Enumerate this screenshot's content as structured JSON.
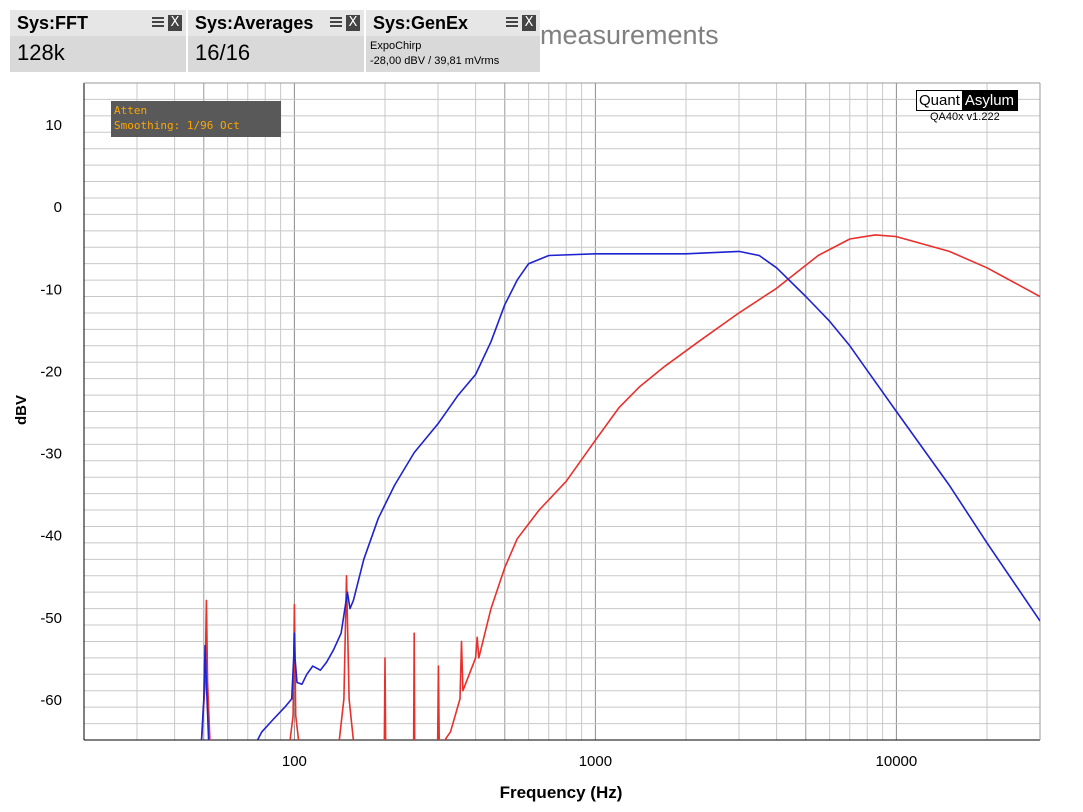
{
  "tiles": [
    {
      "title": "Sys:FFT",
      "value": "128k"
    },
    {
      "title": "Sys:Averages",
      "value": "16/16"
    },
    {
      "title": "Sys:GenEx",
      "line1": "ExpoChirp",
      "line2": "-28,00 dBV / 39,81 mVrms"
    }
  ],
  "page_title": "measurements",
  "logo": {
    "left": "Quant",
    "right": "Asylum",
    "version": "QA40x v1.222"
  },
  "status": {
    "line1": "Atten",
    "line2": "Smoothing: 1/96 Oct",
    "color": "#ffa500"
  },
  "colors": {
    "blue": "#1f22cf",
    "red": "#e8302c",
    "grid_major": "#8c8c8c",
    "grid_minor": "#c8c8c8"
  },
  "chart_data": {
    "type": "line",
    "xlabel": "Frequency (Hz)",
    "ylabel": "dBV",
    "x_scale": "log",
    "xlim": [
      20,
      30000
    ],
    "ylim": [
      -65,
      15
    ],
    "x_ticks": [
      100,
      1000,
      10000
    ],
    "y_ticks": [
      10,
      0,
      -10,
      -20,
      -30,
      -40,
      -50,
      -60
    ],
    "grid": true,
    "series": [
      {
        "color": "#1f22cf",
        "points": [
          [
            49,
            -66
          ],
          [
            50,
            -60
          ],
          [
            50.5,
            -53.5
          ],
          [
            51,
            -58
          ],
          [
            52,
            -66
          ],
          [
            73,
            -66
          ],
          [
            78,
            -64
          ],
          [
            85,
            -62.5
          ],
          [
            93,
            -61
          ],
          [
            98,
            -60
          ],
          [
            99.5,
            -55
          ],
          [
            100,
            -52
          ],
          [
            100.5,
            -55
          ],
          [
            102,
            -58
          ],
          [
            106,
            -58.2
          ],
          [
            110,
            -57
          ],
          [
            115,
            -56
          ],
          [
            122,
            -56.5
          ],
          [
            128,
            -55.5
          ],
          [
            135,
            -54
          ],
          [
            143,
            -52
          ],
          [
            150,
            -47
          ],
          [
            153,
            -49
          ],
          [
            157,
            -48
          ],
          [
            170,
            -43
          ],
          [
            190,
            -38
          ],
          [
            215,
            -34
          ],
          [
            250,
            -30
          ],
          [
            300,
            -26.5
          ],
          [
            350,
            -23
          ],
          [
            400,
            -20.5
          ],
          [
            450,
            -16.5
          ],
          [
            500,
            -12
          ],
          [
            550,
            -9
          ],
          [
            600,
            -7
          ],
          [
            700,
            -6
          ],
          [
            1000,
            -5.8
          ],
          [
            2000,
            -5.8
          ],
          [
            3000,
            -5.5
          ],
          [
            3500,
            -6
          ],
          [
            4000,
            -7.5
          ],
          [
            5000,
            -11
          ],
          [
            6000,
            -14
          ],
          [
            7000,
            -17
          ],
          [
            8000,
            -20
          ],
          [
            10000,
            -25
          ],
          [
            15000,
            -34
          ],
          [
            20000,
            -41
          ],
          [
            30000,
            -50.5
          ]
        ]
      },
      {
        "color": "#e8302c",
        "points": [
          [
            49,
            -66
          ],
          [
            50.5,
            -58
          ],
          [
            51,
            -48
          ],
          [
            51.5,
            -58
          ],
          [
            52.5,
            -66
          ],
          [
            96,
            -66
          ],
          [
            99,
            -62
          ],
          [
            100,
            -48.5
          ],
          [
            101,
            -62
          ],
          [
            104,
            -66
          ],
          [
            140,
            -66
          ],
          [
            146,
            -60
          ],
          [
            149,
            -45
          ],
          [
            152,
            -60
          ],
          [
            158,
            -66
          ],
          [
            199,
            -66
          ],
          [
            200,
            -55
          ],
          [
            201,
            -66
          ],
          [
            249,
            -66
          ],
          [
            250,
            -52
          ],
          [
            251,
            -66
          ],
          [
            299,
            -66
          ],
          [
            301,
            -56
          ],
          [
            303,
            -66
          ],
          [
            330,
            -64
          ],
          [
            355,
            -60
          ],
          [
            359,
            -53
          ],
          [
            363,
            -59
          ],
          [
            400,
            -55
          ],
          [
            405,
            -52.5
          ],
          [
            410,
            -55
          ],
          [
            450,
            -49
          ],
          [
            500,
            -44
          ],
          [
            550,
            -40.5
          ],
          [
            650,
            -37
          ],
          [
            800,
            -33.5
          ],
          [
            1000,
            -28.5
          ],
          [
            1200,
            -24.5
          ],
          [
            1400,
            -22
          ],
          [
            1700,
            -19.5
          ],
          [
            2200,
            -16.5
          ],
          [
            3000,
            -13
          ],
          [
            4000,
            -10
          ],
          [
            5500,
            -6
          ],
          [
            7000,
            -4
          ],
          [
            8500,
            -3.5
          ],
          [
            10000,
            -3.7
          ],
          [
            15000,
            -5.5
          ],
          [
            20000,
            -7.5
          ],
          [
            30000,
            -11
          ]
        ]
      }
    ]
  }
}
